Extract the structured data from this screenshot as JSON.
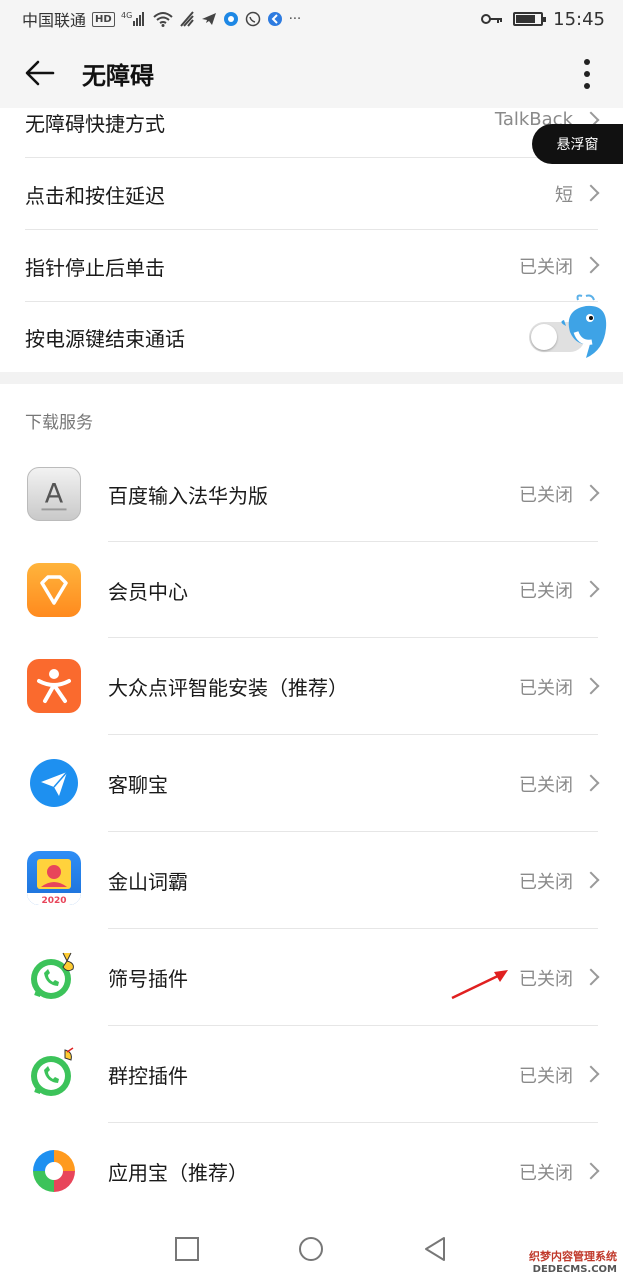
{
  "status_bar": {
    "carrier": "中国联通",
    "hd": "HD",
    "network": "4G",
    "time": "15:45"
  },
  "app_bar": {
    "title": "无障碍"
  },
  "settings": {
    "rows": [
      {
        "label": "无障碍快捷方式",
        "value": "TalkBack"
      },
      {
        "label": "点击和按住延迟",
        "value": "短"
      },
      {
        "label": "指针停止后单击",
        "value": "已关闭"
      },
      {
        "label": "按电源键结束通话",
        "toggle": false
      }
    ]
  },
  "floating_window": {
    "label": "悬浮窗"
  },
  "download_services": {
    "title": "下载服务",
    "apps": [
      {
        "name": "百度输入法华为版",
        "status": "已关闭",
        "icon": "keyboard-a-icon"
      },
      {
        "name": "会员中心",
        "status": "已关闭",
        "icon": "diamond-icon"
      },
      {
        "name": "大众点评智能安装（推荐）",
        "status": "已关闭",
        "icon": "dianping-icon"
      },
      {
        "name": "客聊宝",
        "status": "已关闭",
        "icon": "paper-plane-icon"
      },
      {
        "name": "金山词霸",
        "status": "已关闭",
        "icon": "ciba-icon",
        "badge": "2020"
      },
      {
        "name": "筛号插件",
        "status": "已关闭",
        "icon": "whatsapp-icon"
      },
      {
        "name": "群控插件",
        "status": "已关闭",
        "icon": "whatsapp-icon"
      },
      {
        "name": "应用宝（推荐）",
        "status": "已关闭",
        "icon": "yingyongbao-icon"
      }
    ]
  },
  "watermark": {
    "line1": "织梦内容管理系统",
    "line2": "DEDECMS.COM"
  },
  "colors": {
    "status_bar_bg": "#f5f5f5",
    "value_gray": "#8a8a8a",
    "arrow_red": "#e02020"
  }
}
